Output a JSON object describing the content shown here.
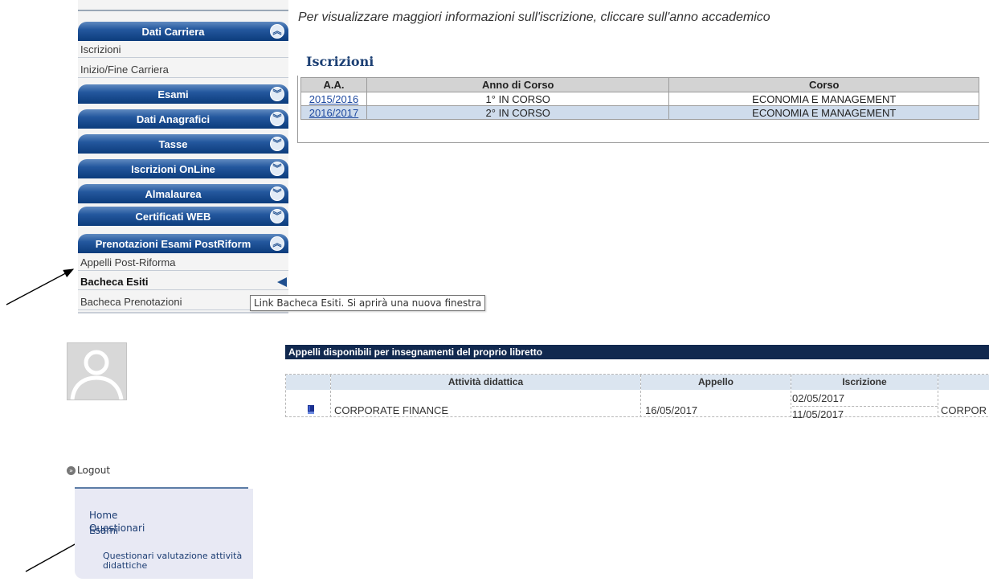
{
  "menu": {
    "sections": [
      {
        "label": "Dati Carriera",
        "expanded": true
      },
      {
        "label": "Esami",
        "expanded": false
      },
      {
        "label": "Dati Anagrafici",
        "expanded": false
      },
      {
        "label": "Tasse",
        "expanded": false
      },
      {
        "label": "Iscrizioni OnLine",
        "expanded": false
      },
      {
        "label": "Almalaurea",
        "expanded": false
      },
      {
        "label": "Certificati WEB",
        "expanded": false
      },
      {
        "label": "Prenotazioni Esami PostRiform",
        "expanded": true
      }
    ],
    "dati_carriera_items": [
      "Iscrizioni",
      "Inizio/Fine Carriera"
    ],
    "prenotazioni_items": [
      "Appelli Post-Riforma",
      "Bacheca Esiti",
      "Bacheca Prenotazioni"
    ],
    "expand_icon": "chevron-down-circle-icon",
    "collapse_icon": "chevron-up-circle-icon"
  },
  "iscrizioni": {
    "info": "Per visualizzare maggiori informazioni sull'iscrizione, cliccare sull'anno accademico",
    "title": "Iscrizioni",
    "headers": [
      "A.A.",
      "Anno di Corso",
      "Corso"
    ],
    "rows": [
      {
        "aa": "2015/2016",
        "anno": "1° IN CORSO",
        "corso": "ECONOMIA E MANAGEMENT"
      },
      {
        "aa": "2016/2017",
        "anno": "2° IN CORSO",
        "corso": "ECONOMIA E MANAGEMENT"
      }
    ]
  },
  "tooltip": "Link Bacheca Esiti. Si aprirà una nuova finestra",
  "sidebar": {
    "logout": "Logout",
    "links": [
      "Home",
      "Esami",
      "Questionari"
    ],
    "sub_link": "Questionari valutazione attività didattiche"
  },
  "appelli": {
    "title": "Appelli disponibili per insegnamenti del proprio libretto",
    "headers": [
      "Attività didattica",
      "Appello",
      "Iscrizione"
    ],
    "row": {
      "attivita": "CORPORATE FINANCE",
      "appello": "16/05/2017",
      "iscrizione_da": "02/05/2017",
      "iscrizione_a": "11/05/2017",
      "extra": "CORPOR"
    }
  },
  "colors": {
    "menu_header": "#24589e",
    "dark_bar": "#11294f",
    "row_highlight": "#cfdcec"
  }
}
